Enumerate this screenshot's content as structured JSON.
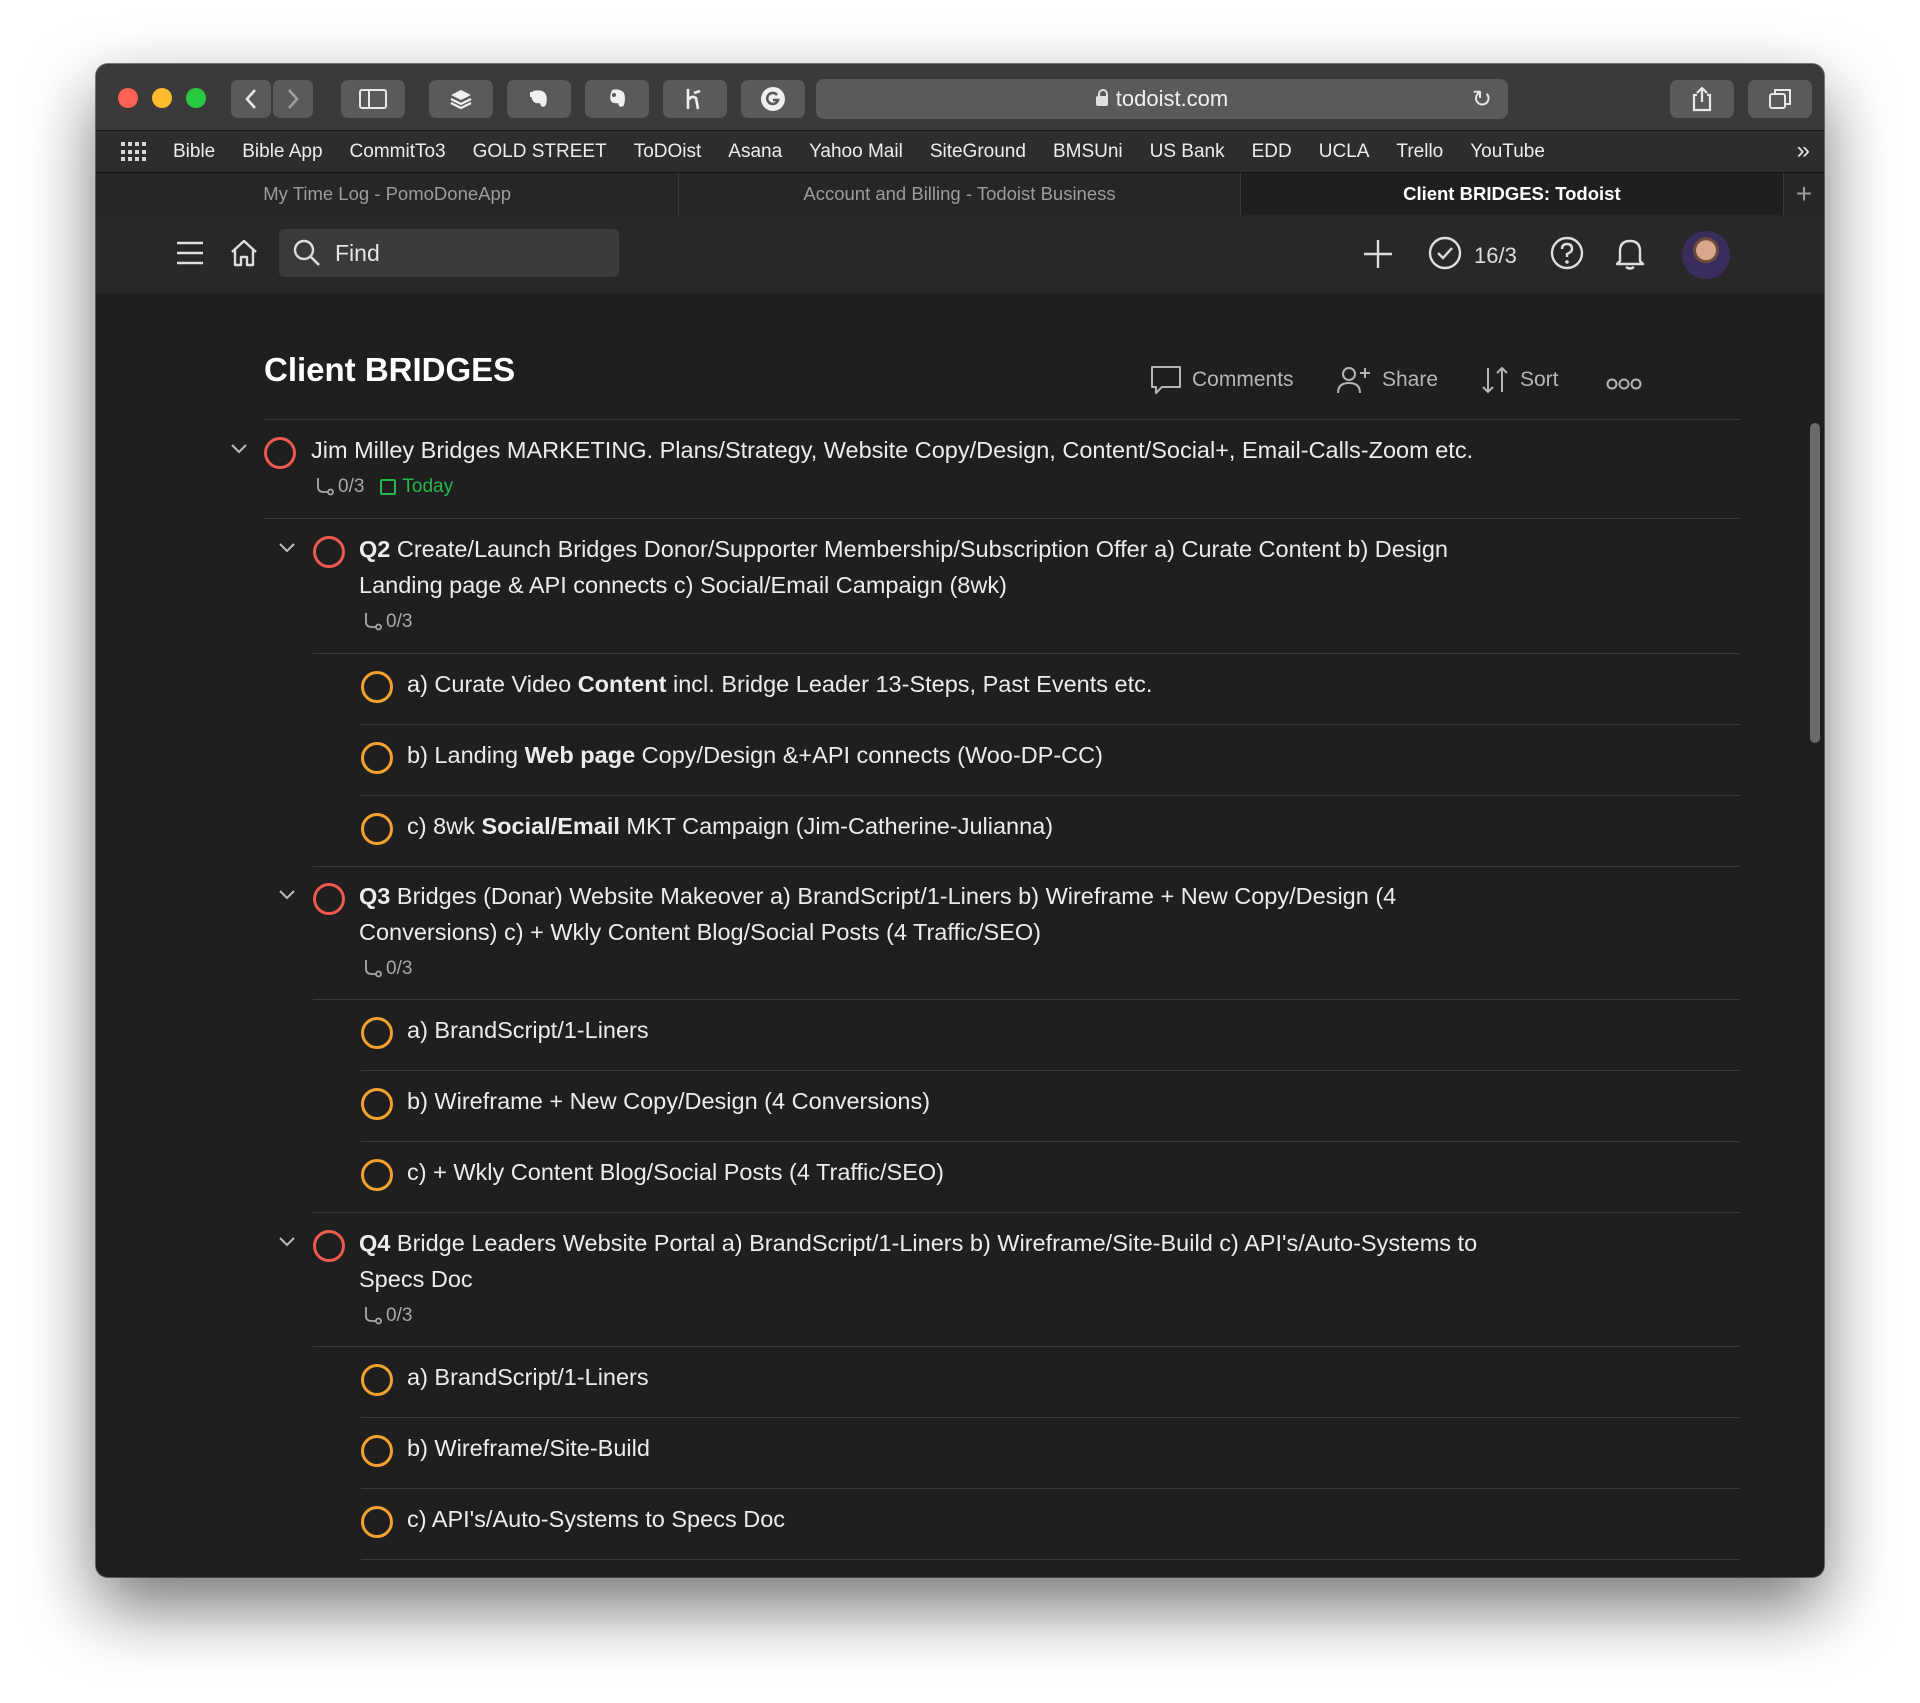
{
  "browser": {
    "url": "todoist.com",
    "bookmarks": [
      "Bible",
      "Bible App",
      "CommitTo3",
      "GOLD STREET",
      "ToDOist",
      "Asana",
      "Yahoo Mail",
      "SiteGround",
      "BMSUni",
      "US Bank",
      "EDD",
      "UCLA",
      "Trello",
      "YouTube"
    ],
    "tabs": [
      {
        "label": "My Time Log - PomoDoneApp"
      },
      {
        "label": "Account and Billing - Todoist Business"
      },
      {
        "label": "Client BRIDGES: Todoist"
      }
    ]
  },
  "header": {
    "search_placeholder": "Find",
    "karma": "16/3"
  },
  "project": {
    "title": "Client BRIDGES",
    "actions": {
      "comments": "Comments",
      "share": "Share",
      "sort": "Sort"
    }
  },
  "tasks": {
    "root": {
      "text": "Jim Milley Bridges MARKETING. Plans/Strategy, Website Copy/Design, Content/Social+, Email-Calls-Zoom etc.",
      "subtasks": "0/3",
      "due": "Today"
    },
    "q2": {
      "prefix": "Q2",
      "line1": " Create/Launch Bridges Donor/Supporter Membership/Subscription Offer a) Curate Content b) Design",
      "line2": "Landing page & API connects c) Social/Email Campaign (8wk)",
      "subtasks": "0/3",
      "children": [
        {
          "pre": "a) Curate Video ",
          "bold": "Content",
          "post": " incl. Bridge Leader 13-Steps, Past Events etc."
        },
        {
          "pre": "b) Landing ",
          "bold": "Web page",
          "post": " Copy/Design &+API connects (Woo-DP-CC)"
        },
        {
          "pre": "c) 8wk ",
          "bold": "Social/Email",
          "post": " MKT Campaign (Jim-Catherine-Julianna)"
        }
      ]
    },
    "q3": {
      "prefix": "Q3",
      "line1": " Bridges (Donar) Website Makeover a) BrandScript/1-Liners b) Wireframe + New Copy/Design (4",
      "line2": "Conversions) c) + Wkly Content Blog/Social Posts (4 Traffic/SEO)",
      "subtasks": "0/3",
      "children": [
        {
          "text": "a) BrandScript/1-Liners"
        },
        {
          "text": "b) Wireframe + New Copy/Design (4 Conversions)"
        },
        {
          "text": "c) + Wkly Content Blog/Social Posts (4 Traffic/SEO)"
        }
      ]
    },
    "q4": {
      "prefix": "Q4",
      "line1": " Bridge Leaders Website Portal a) BrandScript/1-Liners b) Wireframe/Site-Build c) API's/Auto-Systems to",
      "line2": "Specs Doc",
      "subtasks": "0/3",
      "children": [
        {
          "text": "a) BrandScript/1-Liners"
        },
        {
          "text": "b) Wireframe/Site-Build"
        },
        {
          "text": "c) API's/Auto-Systems to Specs Doc"
        }
      ]
    }
  },
  "colors": {
    "priority_red": "#ee5a50",
    "priority_orange": "#f3a22f",
    "due_today": "#26b84e"
  }
}
